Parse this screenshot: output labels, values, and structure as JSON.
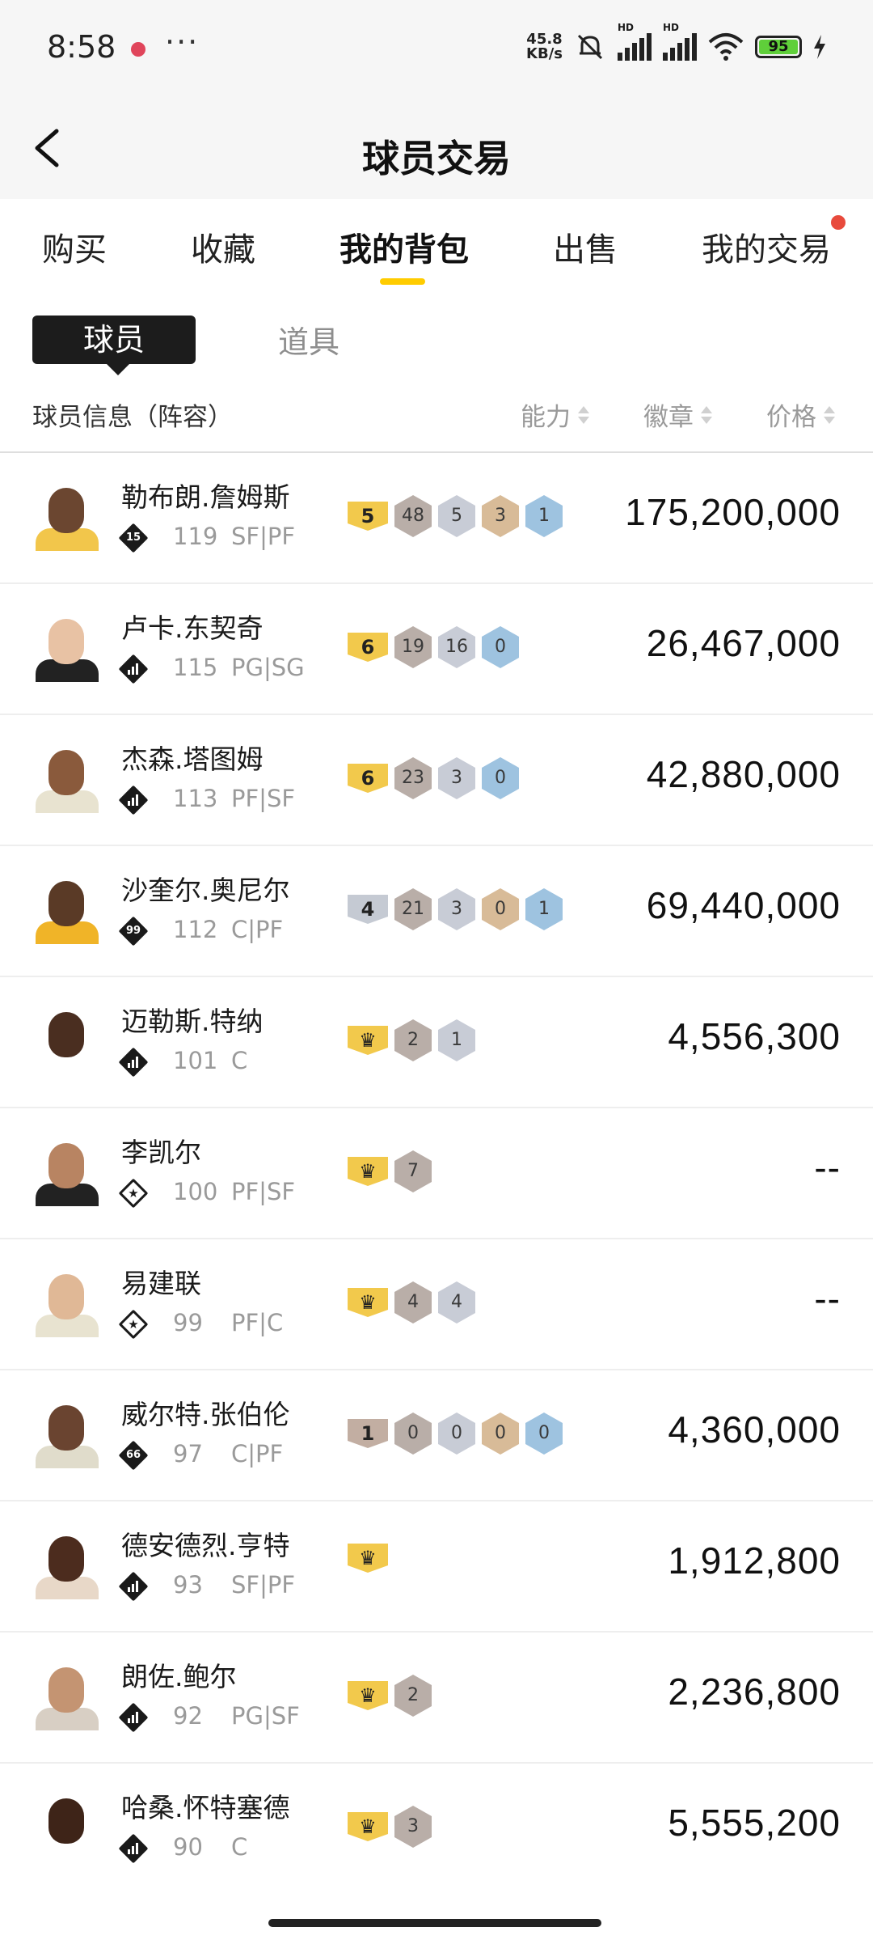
{
  "status_bar": {
    "time": "8:58",
    "more": "···",
    "net_speed_value": "45.8",
    "net_speed_unit": "KB/s",
    "hd1": "HD",
    "hd2": "HD",
    "battery": "95",
    "battery_level": 0.95
  },
  "header": {
    "title": "球员交易"
  },
  "tabs": [
    {
      "label": "购买"
    },
    {
      "label": "收藏"
    },
    {
      "label": "我的背包",
      "active": true
    },
    {
      "label": "出售"
    },
    {
      "label": "我的交易",
      "badge": true
    }
  ],
  "subtabs": {
    "active": "球员",
    "other": "道具"
  },
  "columns": {
    "info": "球员信息（阵容）",
    "ability": "能力",
    "badges": "徽章",
    "price": "价格"
  },
  "players": [
    {
      "name": "勒布朗.詹姆斯",
      "emblem": "15",
      "emblem_type": "num",
      "ovr": "119",
      "pos": "SF|PF",
      "level": {
        "text": "5",
        "color": "gold"
      },
      "badges": [
        {
          "v": "48",
          "c": "hof"
        },
        {
          "v": "5",
          "c": "silver"
        },
        {
          "v": "3",
          "c": "gold"
        },
        {
          "v": "1",
          "c": "blue"
        }
      ],
      "price": "175,200,000",
      "skin": "#6b4630",
      "jersey": "#f2c64b"
    },
    {
      "name": "卢卡.东契奇",
      "emblem": "",
      "emblem_type": "bars",
      "ovr": "115",
      "pos": "PG|SG",
      "level": {
        "text": "6",
        "color": "gold"
      },
      "badges": [
        {
          "v": "19",
          "c": "hof"
        },
        {
          "v": "16",
          "c": "silver"
        },
        {
          "v": "0",
          "c": "blue"
        }
      ],
      "price": "26,467,000",
      "skin": "#e8c2a4",
      "jersey": "#222222"
    },
    {
      "name": "杰森.塔图姆",
      "emblem": "",
      "emblem_type": "bars",
      "ovr": "113",
      "pos": "PF|SF",
      "level": {
        "text": "6",
        "color": "gold"
      },
      "badges": [
        {
          "v": "23",
          "c": "hof"
        },
        {
          "v": "3",
          "c": "silver"
        },
        {
          "v": "0",
          "c": "blue"
        }
      ],
      "price": "42,880,000",
      "skin": "#8a5a3c",
      "jersey": "#e8e3d0"
    },
    {
      "name": "沙奎尔.奥尼尔",
      "emblem": "99",
      "emblem_type": "num",
      "ovr": "112",
      "pos": "C|PF",
      "level": {
        "text": "4",
        "color": "silver"
      },
      "badges": [
        {
          "v": "21",
          "c": "hof"
        },
        {
          "v": "3",
          "c": "silver"
        },
        {
          "v": "0",
          "c": "gold"
        },
        {
          "v": "1",
          "c": "blue"
        }
      ],
      "price": "69,440,000",
      "skin": "#5a3a26",
      "jersey": "#f0b428"
    },
    {
      "name": "迈勒斯.特纳",
      "emblem": "",
      "emblem_type": "bars",
      "ovr": "101",
      "pos": "C",
      "level": {
        "text": "♛",
        "color": "gold"
      },
      "badges": [
        {
          "v": "2",
          "c": "hof"
        },
        {
          "v": "1",
          "c": "silver"
        }
      ],
      "price": "4,556,300",
      "skin": "#4a2e20",
      "jersey": "#ffffff"
    },
    {
      "name": "李凯尔",
      "emblem": "★",
      "emblem_type": "star",
      "ovr": "100",
      "pos": "PF|SF",
      "level": {
        "text": "♛",
        "color": "gold"
      },
      "badges": [
        {
          "v": "7",
          "c": "hof"
        }
      ],
      "price": "--",
      "skin": "#b88462",
      "jersey": "#222222"
    },
    {
      "name": "易建联",
      "emblem": "★",
      "emblem_type": "star",
      "ovr": "99",
      "pos": "PF|C",
      "level": {
        "text": "♛",
        "color": "gold"
      },
      "badges": [
        {
          "v": "4",
          "c": "hof"
        },
        {
          "v": "4",
          "c": "silver"
        }
      ],
      "price": "--",
      "skin": "#e0b896",
      "jersey": "#e8e3d0"
    },
    {
      "name": "威尔特.张伯伦",
      "emblem": "66",
      "emblem_type": "num",
      "ovr": "97",
      "pos": "C|PF",
      "level": {
        "text": "1",
        "color": "bronze"
      },
      "badges": [
        {
          "v": "0",
          "c": "hof"
        },
        {
          "v": "0",
          "c": "silver"
        },
        {
          "v": "0",
          "c": "gold"
        },
        {
          "v": "0",
          "c": "blue"
        }
      ],
      "price": "4,360,000",
      "skin": "#6a4430",
      "jersey": "#e0dccb"
    },
    {
      "name": "德安德烈.亨特",
      "emblem": "",
      "emblem_type": "bars",
      "ovr": "93",
      "pos": "SF|PF",
      "level": {
        "text": "♛",
        "color": "gold"
      },
      "badges": [],
      "price": "1,912,800",
      "skin": "#4c2c1e",
      "jersey": "#e8d8c8"
    },
    {
      "name": "朗佐.鲍尔",
      "emblem": "",
      "emblem_type": "bars",
      "ovr": "92",
      "pos": "PG|SF",
      "level": {
        "text": "♛",
        "color": "gold"
      },
      "badges": [
        {
          "v": "2",
          "c": "hof"
        }
      ],
      "price": "2,236,800",
      "skin": "#c49472",
      "jersey": "#d8cfc4"
    },
    {
      "name": "哈桑.怀特塞德",
      "emblem": "",
      "emblem_type": "bars",
      "ovr": "90",
      "pos": "C",
      "level": {
        "text": "♛",
        "color": "gold"
      },
      "badges": [
        {
          "v": "3",
          "c": "hof"
        }
      ],
      "price": "5,555,200",
      "skin": "#3e2418",
      "jersey": "#ffffff"
    }
  ]
}
